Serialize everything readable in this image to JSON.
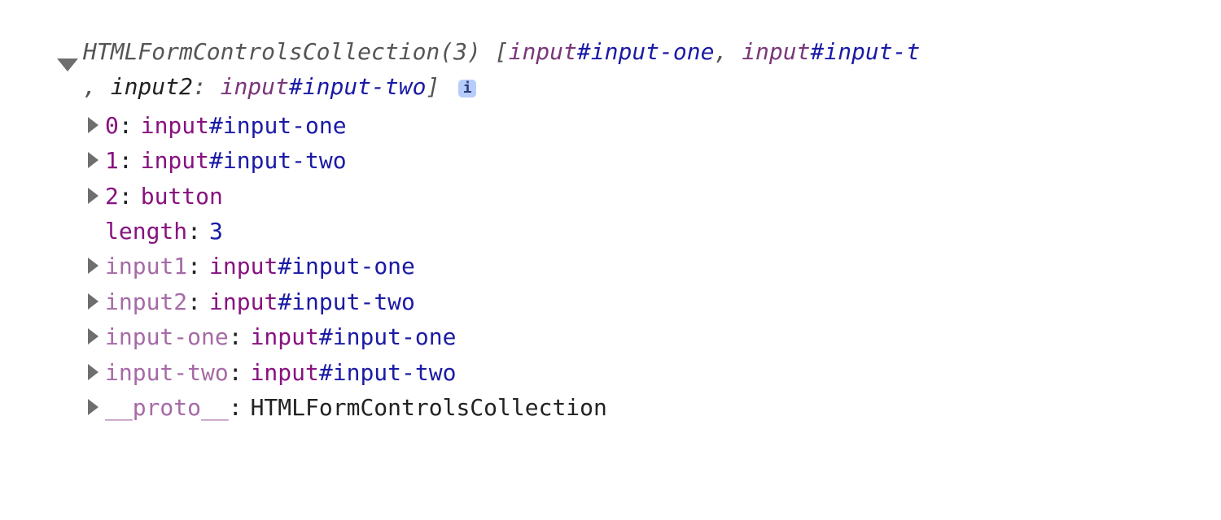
{
  "summary": {
    "type_label": "HTMLFormControlsCollection(3)",
    "open_bracket": " [",
    "close_tail": "]",
    "continuation": ", ",
    "preview_items": [
      {
        "tag": "input",
        "id": "#input-one"
      },
      {
        "tag": "input",
        "id": "#input-t"
      }
    ],
    "line2_key": "input2",
    "line2_colon": ": ",
    "line2_value": {
      "tag": "input",
      "id": "#input-two"
    },
    "info_glyph": "i"
  },
  "props": [
    {
      "expandable": true,
      "dim": false,
      "key": "0",
      "value": {
        "kind": "node",
        "tag": "input",
        "id": "#input-one"
      }
    },
    {
      "expandable": true,
      "dim": false,
      "key": "1",
      "value": {
        "kind": "node",
        "tag": "input",
        "id": "#input-two"
      }
    },
    {
      "expandable": true,
      "dim": false,
      "key": "2",
      "value": {
        "kind": "node",
        "tag": "button",
        "id": ""
      }
    },
    {
      "expandable": false,
      "dim": false,
      "key": "length",
      "value": {
        "kind": "number",
        "text": "3"
      }
    },
    {
      "expandable": true,
      "dim": true,
      "key": "input1",
      "value": {
        "kind": "node",
        "tag": "input",
        "id": "#input-one"
      }
    },
    {
      "expandable": true,
      "dim": true,
      "key": "input2",
      "value": {
        "kind": "node",
        "tag": "input",
        "id": "#input-two"
      }
    },
    {
      "expandable": true,
      "dim": true,
      "key": "input-one",
      "value": {
        "kind": "node",
        "tag": "input",
        "id": "#input-one"
      }
    },
    {
      "expandable": true,
      "dim": true,
      "key": "input-two",
      "value": {
        "kind": "node",
        "tag": "input",
        "id": "#input-two"
      }
    },
    {
      "expandable": true,
      "dim": true,
      "key": "__proto__",
      "value": {
        "kind": "plain",
        "text": "HTMLFormControlsCollection"
      }
    }
  ]
}
